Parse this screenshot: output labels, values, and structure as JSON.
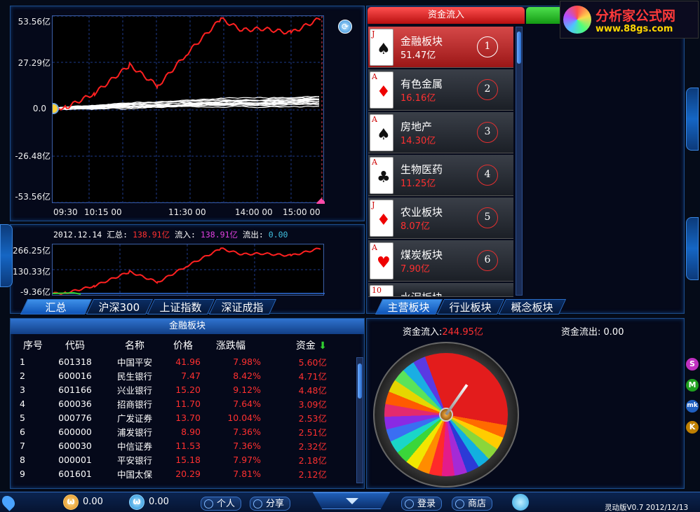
{
  "main_chart": {
    "y_labels": [
      "53.56亿",
      "27.29亿",
      "0.0",
      "-26.48亿",
      "-53.56亿"
    ],
    "x_labels": [
      "09:30",
      "10:15 00",
      "11:30 00",
      "14:00 00",
      "15:00 00"
    ]
  },
  "summary": {
    "date": "2012.12.14",
    "total_label": "汇总:",
    "total_value": "138.91亿",
    "inflow_label": "流入:",
    "inflow_value": "138.91亿",
    "outflow_label": "流出:",
    "outflow_value": "0.00",
    "y_labels": [
      "266.25亿",
      "130.33亿",
      "-9.36亿"
    ]
  },
  "index_tabs": [
    "汇总",
    "沪深300",
    "上证指数",
    "深证成指"
  ],
  "fund_tabs": [
    "资金流入",
    ""
  ],
  "logo": {
    "text": "分析家公式网",
    "url_text": "www.88gs.com"
  },
  "sectors": [
    {
      "name": "金融板块",
      "value": "51.47亿",
      "rank": "1",
      "card_rank": "J",
      "suit": "♠"
    },
    {
      "name": "有色金属",
      "value": "16.16亿",
      "rank": "2",
      "card_rank": "A",
      "suit": "♦"
    },
    {
      "name": "房地产",
      "value": "14.30亿",
      "rank": "3",
      "card_rank": "A",
      "suit": "♠"
    },
    {
      "name": "生物医药",
      "value": "11.25亿",
      "rank": "4",
      "card_rank": "A",
      "suit": "♣"
    },
    {
      "name": "农业板块",
      "value": "8.07亿",
      "rank": "5",
      "card_rank": "J",
      "suit": "♦"
    },
    {
      "name": "煤炭板块",
      "value": "7.90亿",
      "rank": "6",
      "card_rank": "A",
      "suit": "♥"
    },
    {
      "name": "水泥板块",
      "value": "",
      "rank": "",
      "card_rank": "10",
      "suit": "♣"
    }
  ],
  "sector_tabs": [
    "主营板块",
    "行业板块",
    "概念板块"
  ],
  "wheel": {
    "inflow_label": "资金流入:",
    "inflow_value": "244.95亿",
    "outflow_label": "资金流出:",
    "outflow_value": "0.00"
  },
  "table": {
    "title": "金融板块",
    "headers": [
      "序号",
      "代码",
      "名称",
      "价格",
      "涨跌幅",
      "资金"
    ],
    "rows": [
      [
        "1",
        "601318",
        "中国平安",
        "41.96",
        "7.98%",
        "5.60亿"
      ],
      [
        "2",
        "600016",
        "民生银行",
        "7.47",
        "8.42%",
        "4.71亿"
      ],
      [
        "3",
        "601166",
        "兴业银行",
        "15.20",
        "9.12%",
        "4.48亿"
      ],
      [
        "4",
        "600036",
        "招商银行",
        "11.70",
        "7.64%",
        "3.09亿"
      ],
      [
        "5",
        "000776",
        "广发证券",
        "13.70",
        "10.04%",
        "2.53亿"
      ],
      [
        "6",
        "600000",
        "浦发银行",
        "8.90",
        "7.36%",
        "2.51亿"
      ],
      [
        "7",
        "600030",
        "中信证券",
        "11.53",
        "7.36%",
        "2.32亿"
      ],
      [
        "8",
        "000001",
        "平安银行",
        "15.18",
        "7.97%",
        "2.18亿"
      ],
      [
        "9",
        "601601",
        "中国太保",
        "20.29",
        "7.81%",
        "2.12亿"
      ]
    ]
  },
  "bottom": {
    "coin1": "0.00",
    "coin2": "0.00",
    "personal": "个人",
    "share": "分享",
    "login": "登录",
    "shop": "商店",
    "version": "灵动版V0.7 2012/12/13"
  },
  "right_buttons": [
    "S",
    "M",
    "mk",
    "K"
  ],
  "colors": {
    "accent_red": "#e02020",
    "line_red": "#ff2020",
    "panel_border": "#1d4d8a"
  }
}
